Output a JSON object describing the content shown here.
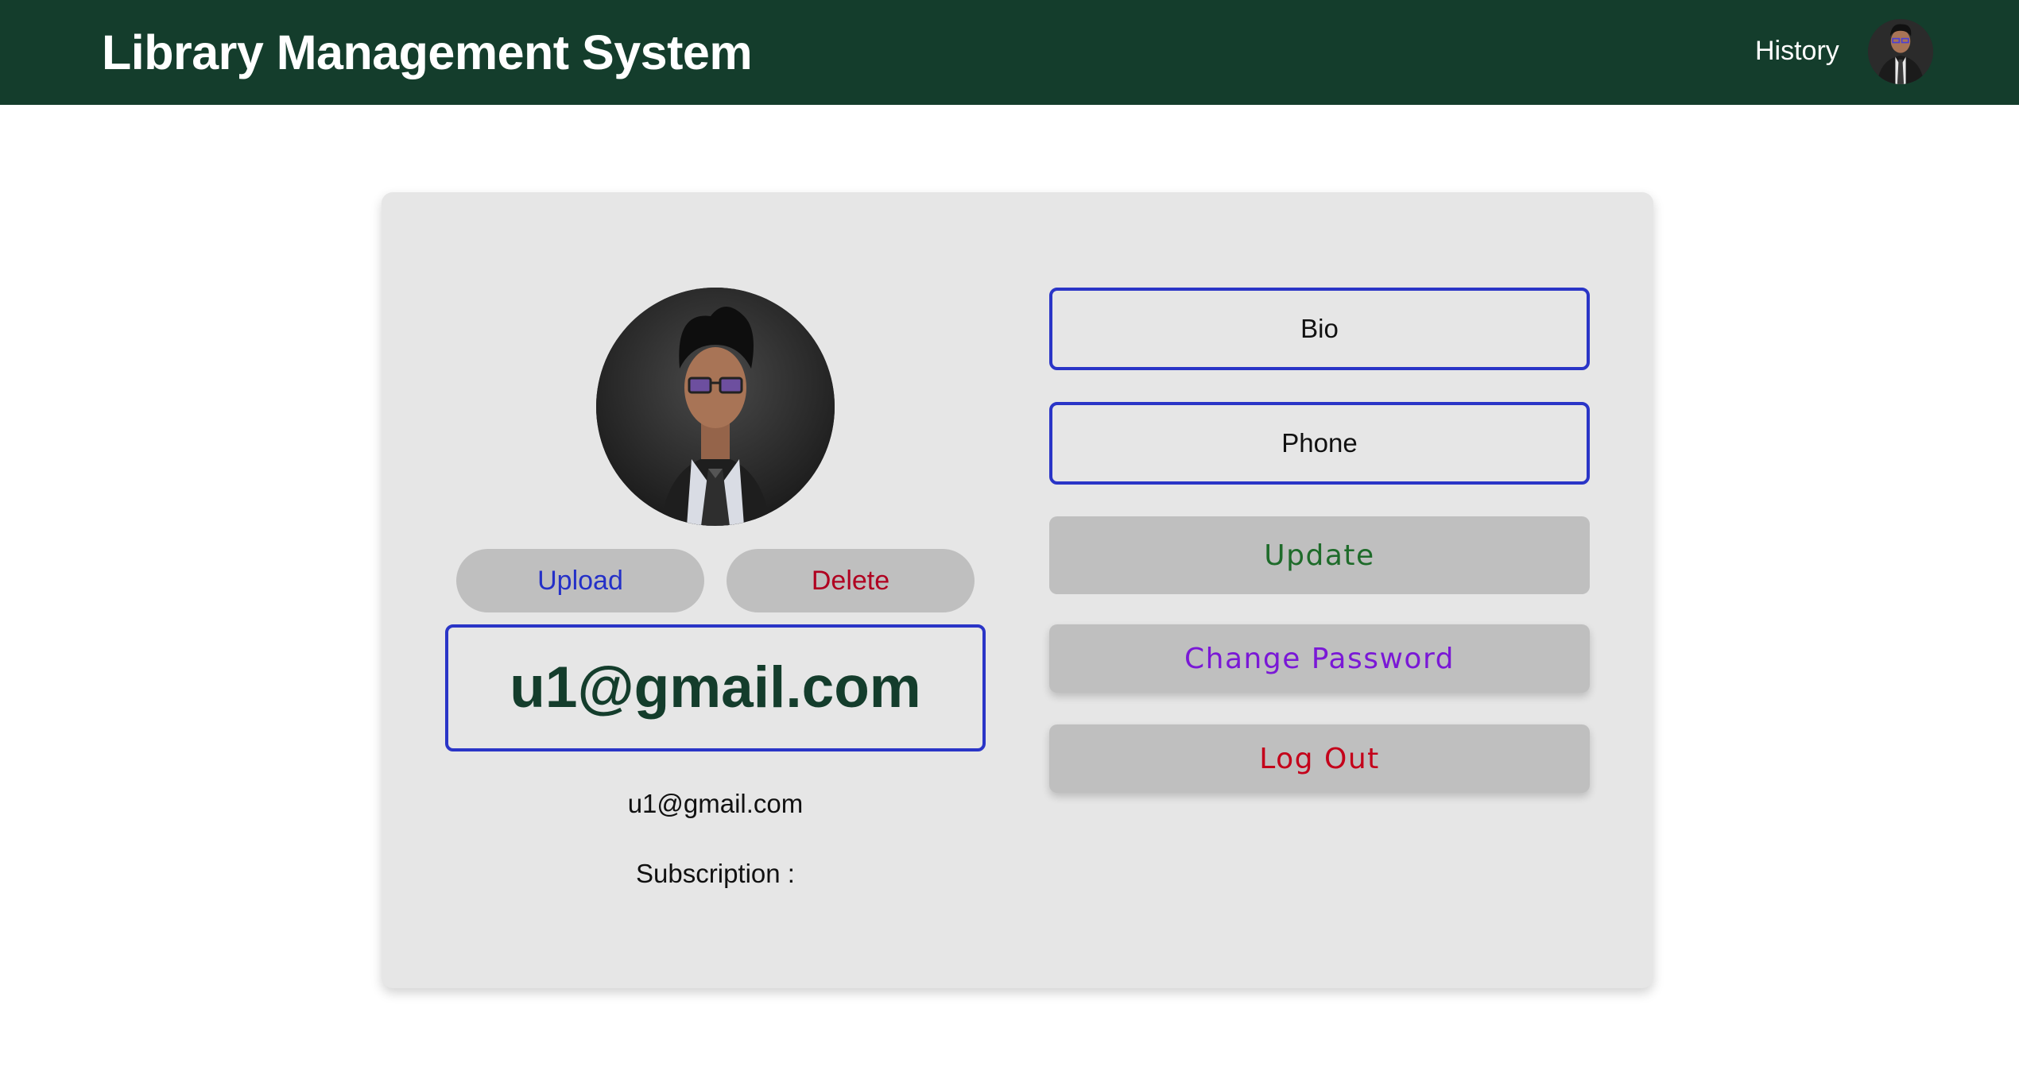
{
  "navbar": {
    "title": "Library Management System",
    "history_label": "History",
    "avatar_icon": "user-avatar-icon",
    "background_color": "#143d2c"
  },
  "profile": {
    "photo_icon": "profile-photo-icon",
    "upload_label": "Upload",
    "delete_label": "Delete",
    "display_name": "u1@gmail.com",
    "email": "u1@gmail.com",
    "subscription_label": "Subscription :",
    "subscription_value": ""
  },
  "form": {
    "bio_placeholder": "Bio",
    "bio_value": "",
    "phone_placeholder": "Phone",
    "phone_value": "",
    "update_label": "Update",
    "change_password_label": "Change Password",
    "logout_label": "Log Out"
  },
  "colors": {
    "accent_blue": "#2a35c7",
    "update_green": "#1e6b2a",
    "password_purple": "#7a18d6",
    "danger_red": "#c4001a",
    "card_bg": "#e6e6e6",
    "button_bg": "#bfbfbf"
  }
}
